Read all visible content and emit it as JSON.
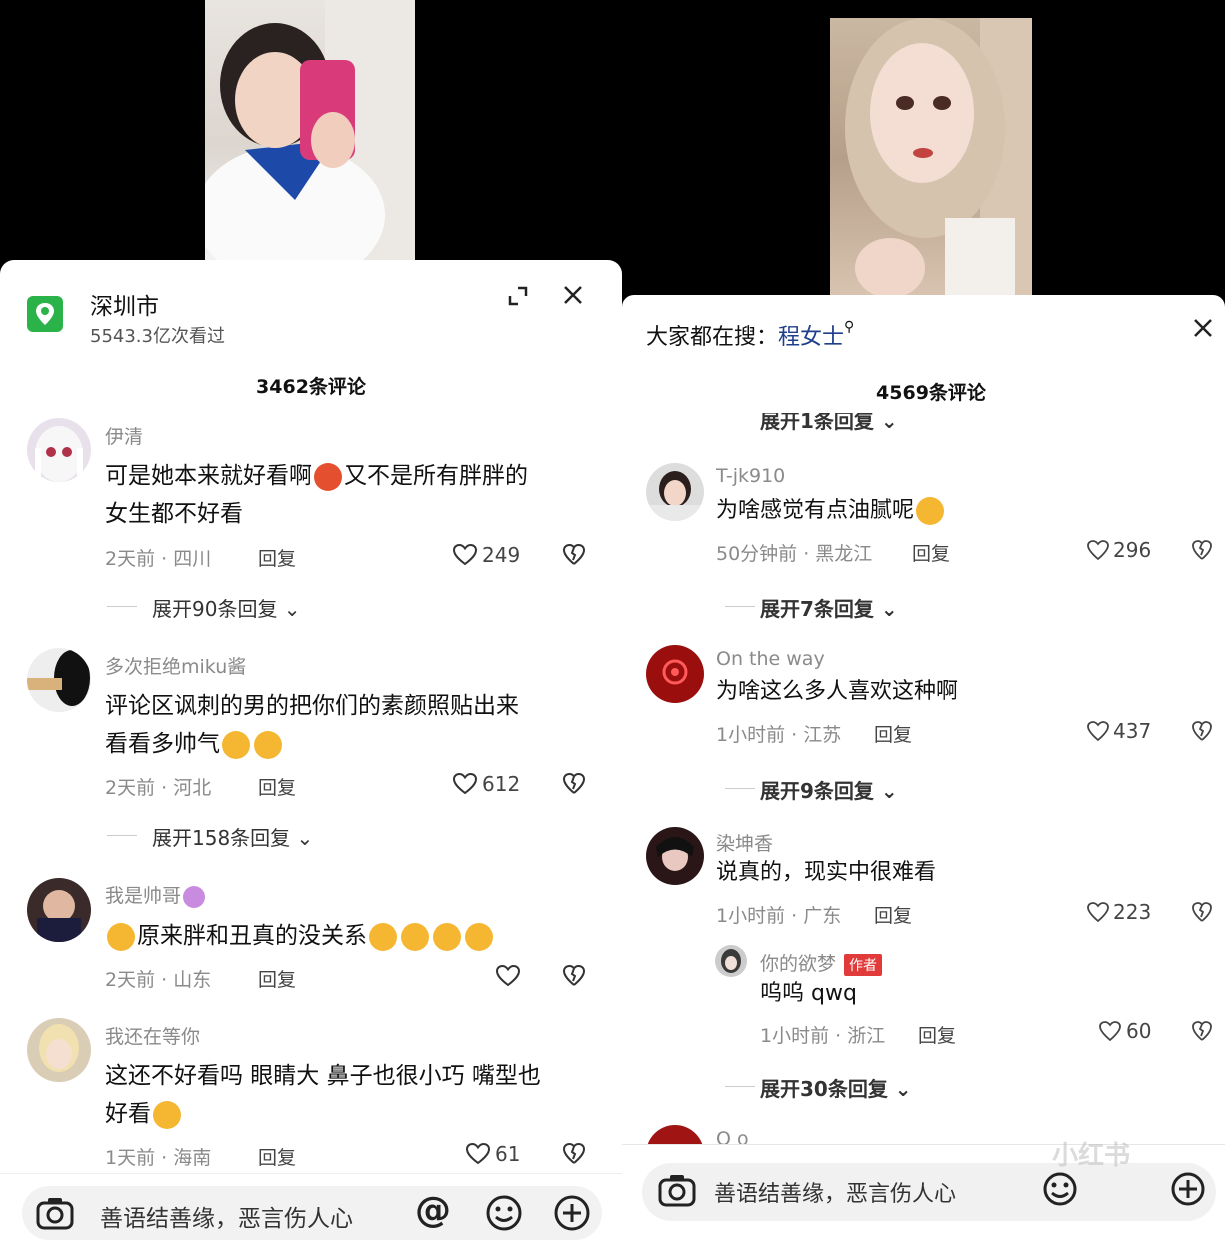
{
  "left": {
    "header": {
      "title": "深圳市",
      "views": "5543.3亿次看过"
    },
    "comment_count": "3462条评论",
    "comments": [
      {
        "user": "伊清",
        "text_a": "可是她本来就好看啊",
        "text_b": "又不是所有胖胖的",
        "text_c": "女生都不好看",
        "time": "2天前 · 四川",
        "reply": "回复",
        "likes": "249",
        "expand": "展开90条回复"
      },
      {
        "user": "多次拒绝miku酱",
        "text_a": "评论区讽刺的男的把你们的素颜照贴出来",
        "text_b": "看看多帅气",
        "time": "2天前 · 河北",
        "reply": "回复",
        "likes": "612",
        "expand": "展开158条回复"
      },
      {
        "user": "我是帅哥",
        "text_a": "原来胖和丑真的没关系",
        "time": "2天前 · 山东",
        "reply": "回复"
      },
      {
        "user": "我还在等你",
        "text_a": "这还不好看吗 眼睛大 鼻子也很小巧 嘴型也",
        "text_b": "好看",
        "time": "1天前 · 海南",
        "reply": "回复",
        "likes": "61"
      }
    ],
    "input_placeholder": "善语结善缘，恶言伤人心",
    "at_symbol": "@"
  },
  "right": {
    "header": {
      "search_prefix": "大家都在搜：",
      "search_term": "程女士"
    },
    "comment_count": "4569条评论",
    "partial_expand": "展开1条回复",
    "comments": [
      {
        "user": "T-jk910",
        "text": "为啥感觉有点油腻呢",
        "time": "50分钟前 · 黑龙江",
        "reply": "回复",
        "likes": "296",
        "expand": "展开7条回复"
      },
      {
        "user": "On the way",
        "text": "为啥这么多人喜欢这种啊",
        "time": "1小时前 · 江苏",
        "reply": "回复",
        "likes": "437",
        "expand": "展开9条回复"
      },
      {
        "user": "染坤香",
        "text": "说真的，现实中很难看",
        "time": "1小时前 · 广东",
        "reply": "回复",
        "likes": "223"
      }
    ],
    "sub_reply": {
      "user": "你的欲梦",
      "badge": "作者",
      "text": "呜呜 qwq",
      "time": "1小时前 · 浙江",
      "reply": "回复",
      "likes": "60",
      "expand": "展开30条回复"
    },
    "next_user": "Q o",
    "input_placeholder": "善语结善缘，恶言伤人心",
    "watermark": "小红书"
  },
  "colors": {
    "location_green": "#2bb34a",
    "author_red": "#e03a3a",
    "bg": "#000000"
  },
  "icons": [
    "location-pin-icon",
    "expand-icon",
    "close-icon",
    "heart-icon",
    "dislike-icon",
    "chevron-down-icon",
    "camera-icon",
    "at-icon",
    "emoji-icon",
    "plus-icon",
    "search-icon"
  ]
}
